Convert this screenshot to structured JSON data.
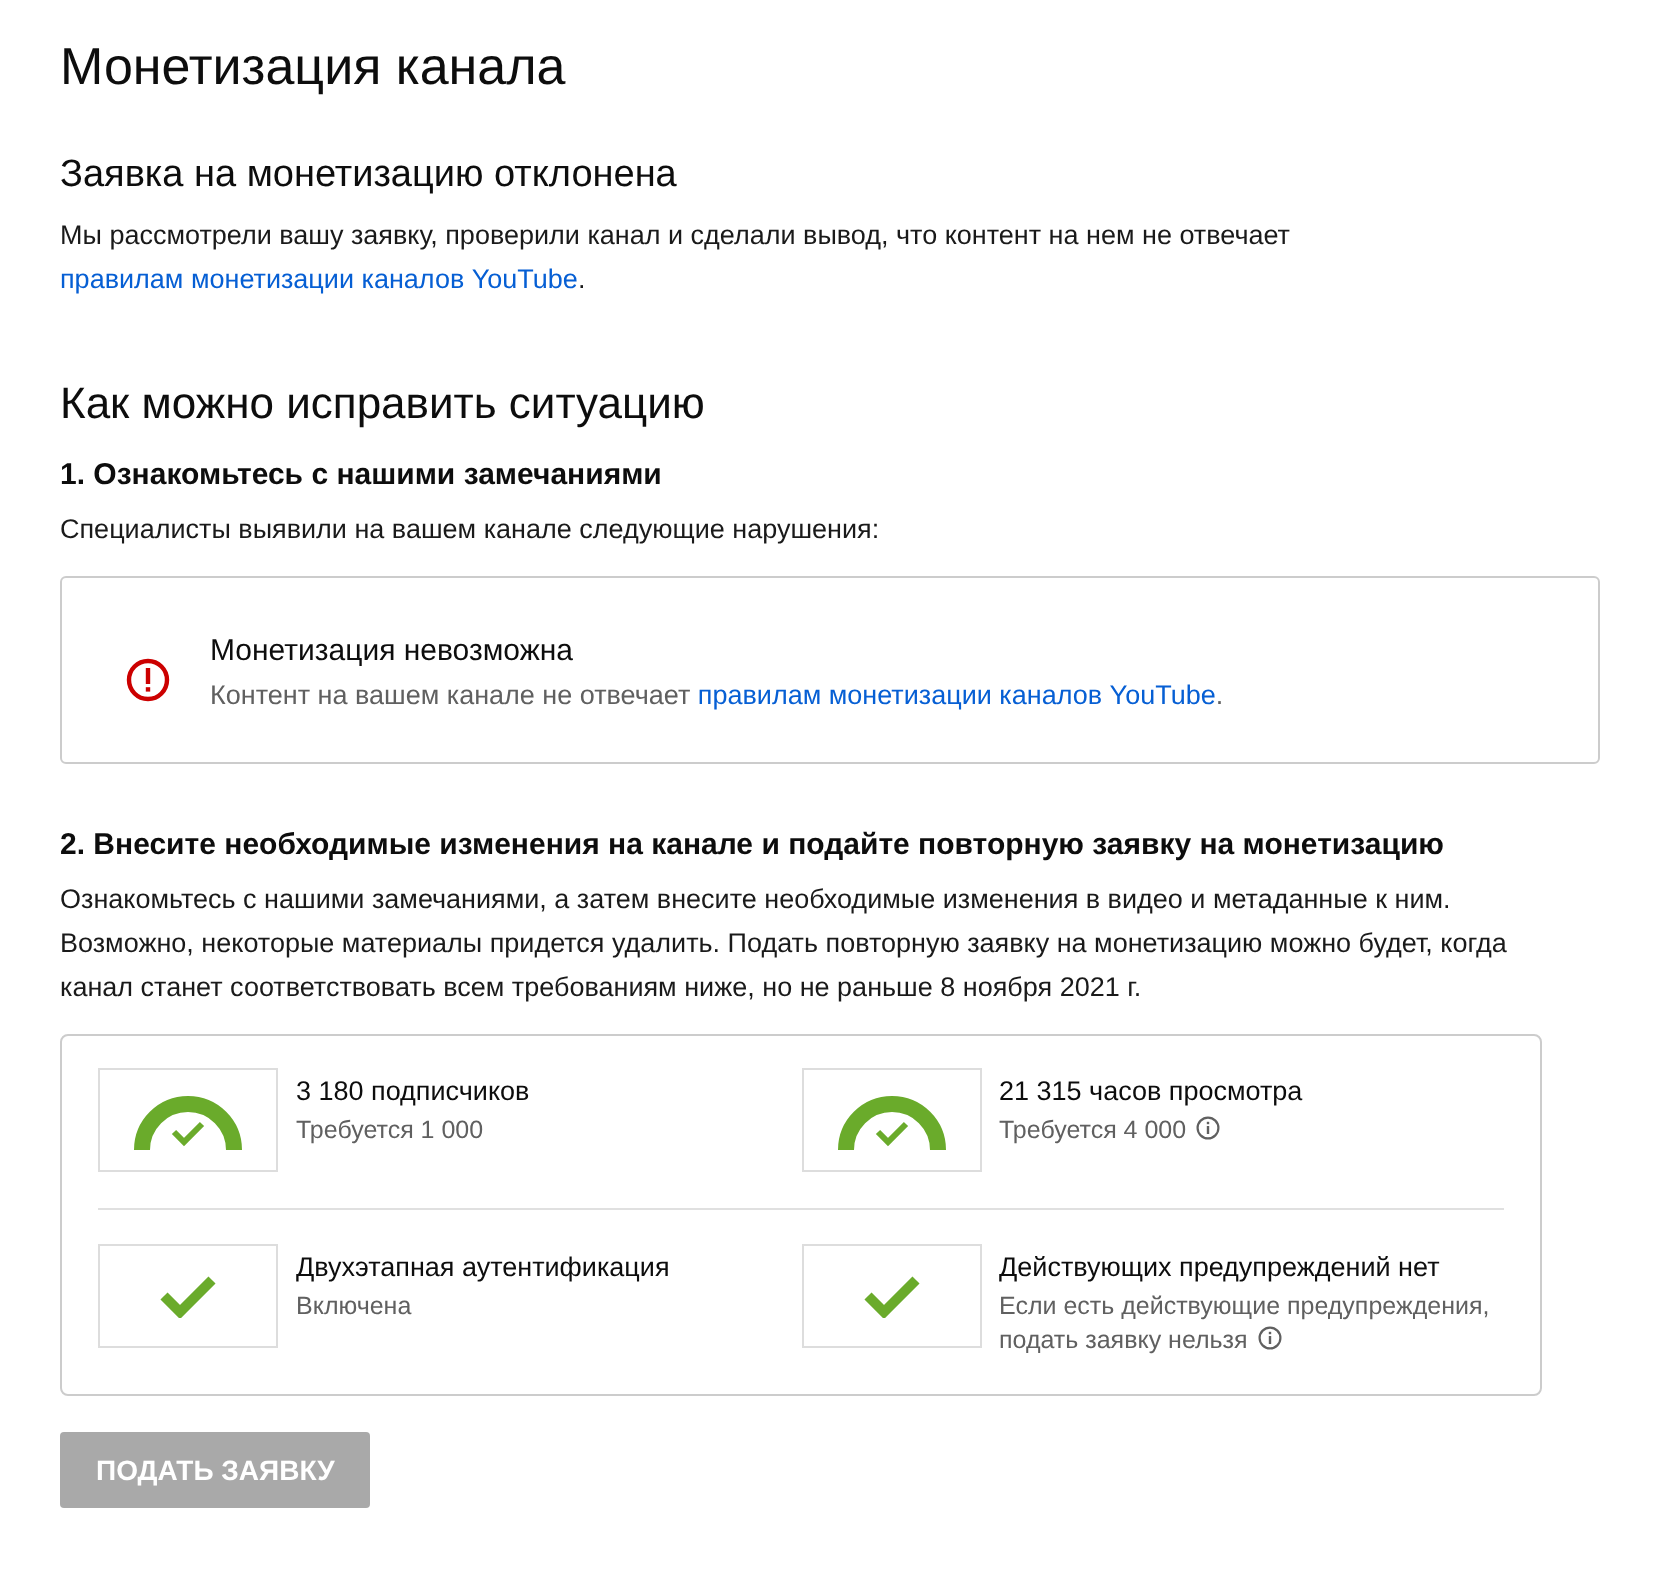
{
  "page_title": "Монетизация канала",
  "status": {
    "heading": "Заявка на монетизацию отклонена",
    "text": "Мы рассмотрели вашу заявку, проверили канал и сделали вывод, что контент на нем не отвечает",
    "link": "правилам монетизации каналов YouTube",
    "suffix": "."
  },
  "fix_heading": "Как можно исправить ситуацию",
  "step1": {
    "heading": "1. Ознакомьтесь с нашими замечаниями",
    "text": "Специалисты выявили на вашем канале следующие нарушения:",
    "issues": [
      {
        "title": "Монетизация невозможна",
        "text": "Контент на вашем канале не отвечает",
        "link": "правилам монетизации каналов YouTube",
        "suffix": "."
      }
    ]
  },
  "step2": {
    "heading": "2. Внесите необходимые изменения на канале и подайте повторную заявку на монетизацию",
    "text": "Ознакомьтесь с нашими замечаниями, а затем внесите необходимые изменения в видео и метаданные к ним. Возможно, некоторые материалы придется удалить. Подать повторную заявку на монетизацию можно будет, когда канал станет соответствовать всем требованиям ниже, но не раньше 8 ноября 2021 г."
  },
  "requirements": [
    {
      "kind": "gauge",
      "title": "3 180 подписчиков",
      "subtitle": "Требуется 1 000",
      "info": false
    },
    {
      "kind": "gauge",
      "title": "21 315 часов просмотра",
      "subtitle": "Требуется 4 000",
      "info": true
    },
    {
      "kind": "check",
      "title": "Двухэтапная аутентификация",
      "subtitle": "Включена",
      "info": false
    },
    {
      "kind": "check",
      "title": "Действующих предупреждений нет",
      "subtitle": "Если есть действующие предупреждения, подать заявку нельзя",
      "info": true
    }
  ],
  "submit_button": {
    "label": "ПОДАТЬ ЗАЯВКУ",
    "disabled": true
  }
}
